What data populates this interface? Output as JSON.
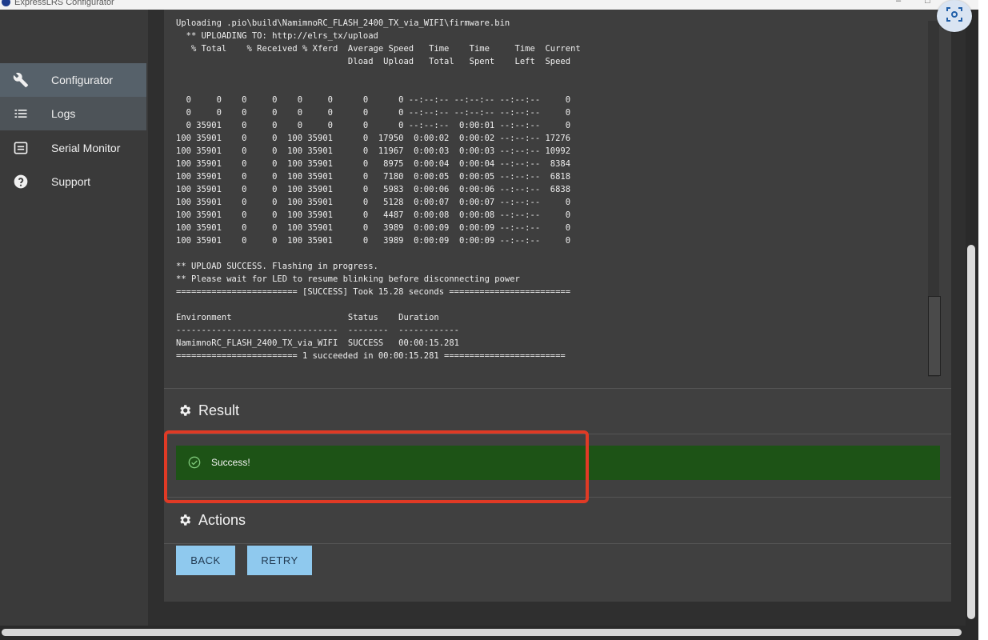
{
  "window": {
    "title": "ExpressLRS Configurator",
    "minimize_glyph": "–",
    "maximize_glyph": "□"
  },
  "sidebar": {
    "items": [
      {
        "label": "Configurator",
        "icon": "wrench-icon"
      },
      {
        "label": "Logs",
        "icon": "list-icon"
      },
      {
        "label": "Serial Monitor",
        "icon": "monitor-icon"
      },
      {
        "label": "Support",
        "icon": "help-icon"
      }
    ]
  },
  "terminal": {
    "lines": [
      "Uploading .pio\\build\\NamimnoRC_FLASH_2400_TX_via_WIFI\\firmware.bin",
      "  ** UPLOADING TO: http://elrs_tx/upload",
      "   % Total    % Received % Xferd  Average Speed   Time    Time     Time  Current",
      "                                  Dload  Upload   Total   Spent    Left  Speed",
      "",
      "",
      "  0     0    0     0    0     0      0      0 --:--:-- --:--:-- --:--:--     0",
      "  0     0    0     0    0     0      0      0 --:--:-- --:--:-- --:--:--     0",
      "  0 35901    0     0    0     0      0      0 --:--:--  0:00:01 --:--:--     0",
      "100 35901    0     0  100 35901      0  17950  0:00:02  0:00:02 --:--:-- 17276",
      "100 35901    0     0  100 35901      0  11967  0:00:03  0:00:03 --:--:-- 10992",
      "100 35901    0     0  100 35901      0   8975  0:00:04  0:00:04 --:--:--  8384",
      "100 35901    0     0  100 35901      0   7180  0:00:05  0:00:05 --:--:--  6818",
      "100 35901    0     0  100 35901      0   5983  0:00:06  0:00:06 --:--:--  6838",
      "100 35901    0     0  100 35901      0   5128  0:00:07  0:00:07 --:--:--     0",
      "100 35901    0     0  100 35901      0   4487  0:00:08  0:00:08 --:--:--     0",
      "100 35901    0     0  100 35901      0   3989  0:00:09  0:00:09 --:--:--     0",
      "100 35901    0     0  100 35901      0   3989  0:00:09  0:00:09 --:--:--     0",
      "",
      "** UPLOAD SUCCESS. Flashing in progress.",
      "** Please wait for LED to resume blinking before disconnecting power",
      "======================== [SUCCESS] Took 15.28 seconds ========================",
      "",
      "Environment                       Status    Duration",
      "--------------------------------  --------  ------------",
      "NamimnoRC_FLASH_2400_TX_via_WIFI  SUCCESS   00:00:15.281",
      "======================== 1 succeeded in 00:00:15.281 ========================"
    ]
  },
  "result": {
    "heading": "Result",
    "message": "Success!",
    "bar_color": "#1d5316"
  },
  "actions": {
    "heading": "Actions",
    "back_label": "BACK",
    "retry_label": "RETRY"
  },
  "colors": {
    "highlight": "#e03a25",
    "button_bg": "#8fc9ee"
  }
}
